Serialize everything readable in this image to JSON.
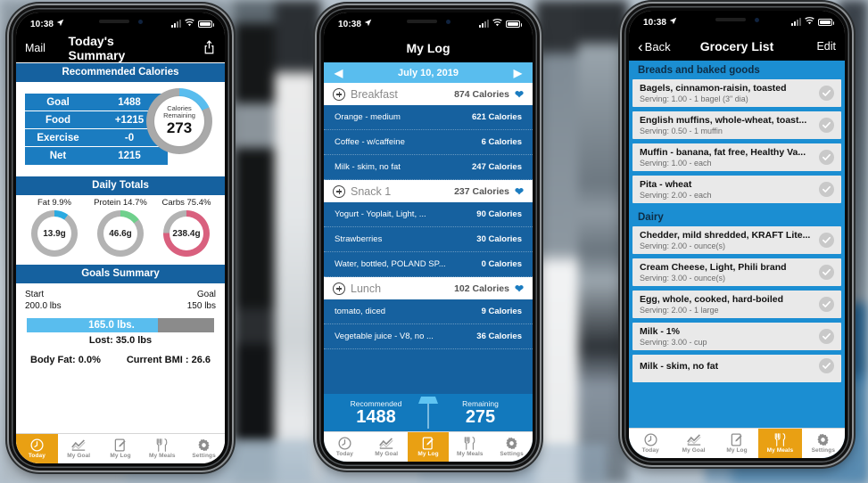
{
  "status_bar": {
    "time": "10:38",
    "location_icon": "location-arrow-icon",
    "signal_icon": "cellular-bars-icon",
    "wifi_icon": "wifi-icon",
    "battery_icon": "battery-icon"
  },
  "tabs": [
    {
      "label": "Today",
      "icon": "clock-icon"
    },
    {
      "label": "My Goal",
      "icon": "line-chart-icon"
    },
    {
      "label": "My Log",
      "icon": "notepad-pencil-icon"
    },
    {
      "label": "My Meals",
      "icon": "fork-knife-icon"
    },
    {
      "label": "Settings",
      "icon": "gear-icon"
    }
  ],
  "colors": {
    "header_blue": "#15619f",
    "row_blue": "#1b7cc0",
    "light_blue": "#59bdee",
    "accent_orange": "#e9a013",
    "grocery_blue": "#1b8ed2",
    "fat": "#2aaae1",
    "protein": "#6fd08c",
    "carbs": "#d9607e",
    "track_gray": "#b0b0b0"
  },
  "phone1": {
    "nav": {
      "left": "Mail",
      "title": "Today's Summary",
      "right_icon": "share-icon"
    },
    "recommended": {
      "header": "Recommended Calories",
      "rows": [
        {
          "label": "Goal",
          "value": "1488"
        },
        {
          "label": "Food",
          "value": "+1215"
        },
        {
          "label": "Exercise",
          "value": "-0"
        },
        {
          "label": "Net",
          "value": "1215"
        }
      ],
      "donut": {
        "label_line1": "Calories",
        "label_line2": "Remaining",
        "value": "273",
        "percent": 18
      }
    },
    "daily_totals": {
      "header": "Daily Totals",
      "macros": [
        {
          "label": "Fat 9.9%",
          "value": "13.9g",
          "percent": 9.9,
          "color": "#2aaae1"
        },
        {
          "label": "Protein 14.7%",
          "value": "46.6g",
          "percent": 14.7,
          "color": "#6fd08c"
        },
        {
          "label": "Carbs 75.4%",
          "value": "238.4g",
          "percent": 75.4,
          "color": "#d9607e"
        }
      ]
    },
    "goals": {
      "header": "Goals Summary",
      "start_label": "Start",
      "start_value": "200.0 lbs",
      "goal_label": "Goal",
      "goal_value": "150 lbs",
      "current": "165.0 lbs.",
      "progress_percent": 70,
      "lost": "Lost:  35.0 lbs",
      "body_fat": "Body Fat: 0.0%",
      "bmi": "Current BMI : 26.6"
    },
    "active_tab": 0
  },
  "phone2": {
    "nav": {
      "title": "My Log"
    },
    "date": "July 10, 2019",
    "prev_icon": "triangle-left-icon",
    "next_icon": "triangle-right-icon",
    "entries": [
      {
        "type": "meal",
        "name": "Breakfast",
        "calories": "874 Calories"
      },
      {
        "type": "food",
        "name": "Orange - medium",
        "calories": "621 Calories"
      },
      {
        "type": "food",
        "name": "Coffee - w/caffeine",
        "calories": "6 Calories"
      },
      {
        "type": "food",
        "name": "Milk - skim, no fat",
        "calories": "247 Calories"
      },
      {
        "type": "meal",
        "name": "Snack 1",
        "calories": "237 Calories"
      },
      {
        "type": "food",
        "name": "Yogurt - Yoplait, Light, ...",
        "calories": "90 Calories"
      },
      {
        "type": "food",
        "name": "Strawberries",
        "calories": "30 Calories"
      },
      {
        "type": "food",
        "name": "Water, bottled, POLAND SP...",
        "calories": "0 Calories"
      },
      {
        "type": "meal",
        "name": "Lunch",
        "calories": "102 Calories"
      },
      {
        "type": "food",
        "name": "tomato, diced",
        "calories": "9 Calories"
      },
      {
        "type": "food",
        "name": "Vegetable juice - V8, no ...",
        "calories": "36 Calories"
      }
    ],
    "summary": {
      "recommended_label": "Recommended",
      "recommended_value": "1488",
      "remaining_label": "Remaining",
      "remaining_value": "275"
    },
    "active_tab": 2
  },
  "phone3": {
    "nav": {
      "back": "Back",
      "title": "Grocery List",
      "right": "Edit"
    },
    "sections": [
      {
        "title": "Breads and baked goods",
        "items": [
          {
            "name": "Bagels, cinnamon-raisin, toasted",
            "serving": "Serving: 1.00 - 1 bagel (3\" dia)"
          },
          {
            "name": "English muffins, whole-wheat, toast...",
            "serving": "Serving: 0.50 - 1 muffin"
          },
          {
            "name": "Muffin - banana, fat free, Healthy Va...",
            "serving": "Serving: 1.00 - each"
          },
          {
            "name": "Pita - wheat",
            "serving": "Serving: 2.00 - each"
          }
        ]
      },
      {
        "title": "Dairy",
        "items": [
          {
            "name": "Chedder, mild shredded, KRAFT Lite...",
            "serving": "Serving: 2.00 - ounce(s)"
          },
          {
            "name": "Cream Cheese, Light, Phili brand",
            "serving": "Serving: 3.00 - ounce(s)"
          },
          {
            "name": "Egg, whole, cooked, hard-boiled",
            "serving": "Serving: 2.00 - 1 large"
          },
          {
            "name": "Milk - 1%",
            "serving": "Serving: 3.00 - cup"
          },
          {
            "name": "Milk - skim, no fat",
            "serving": ""
          }
        ]
      }
    ],
    "active_tab": 3
  }
}
